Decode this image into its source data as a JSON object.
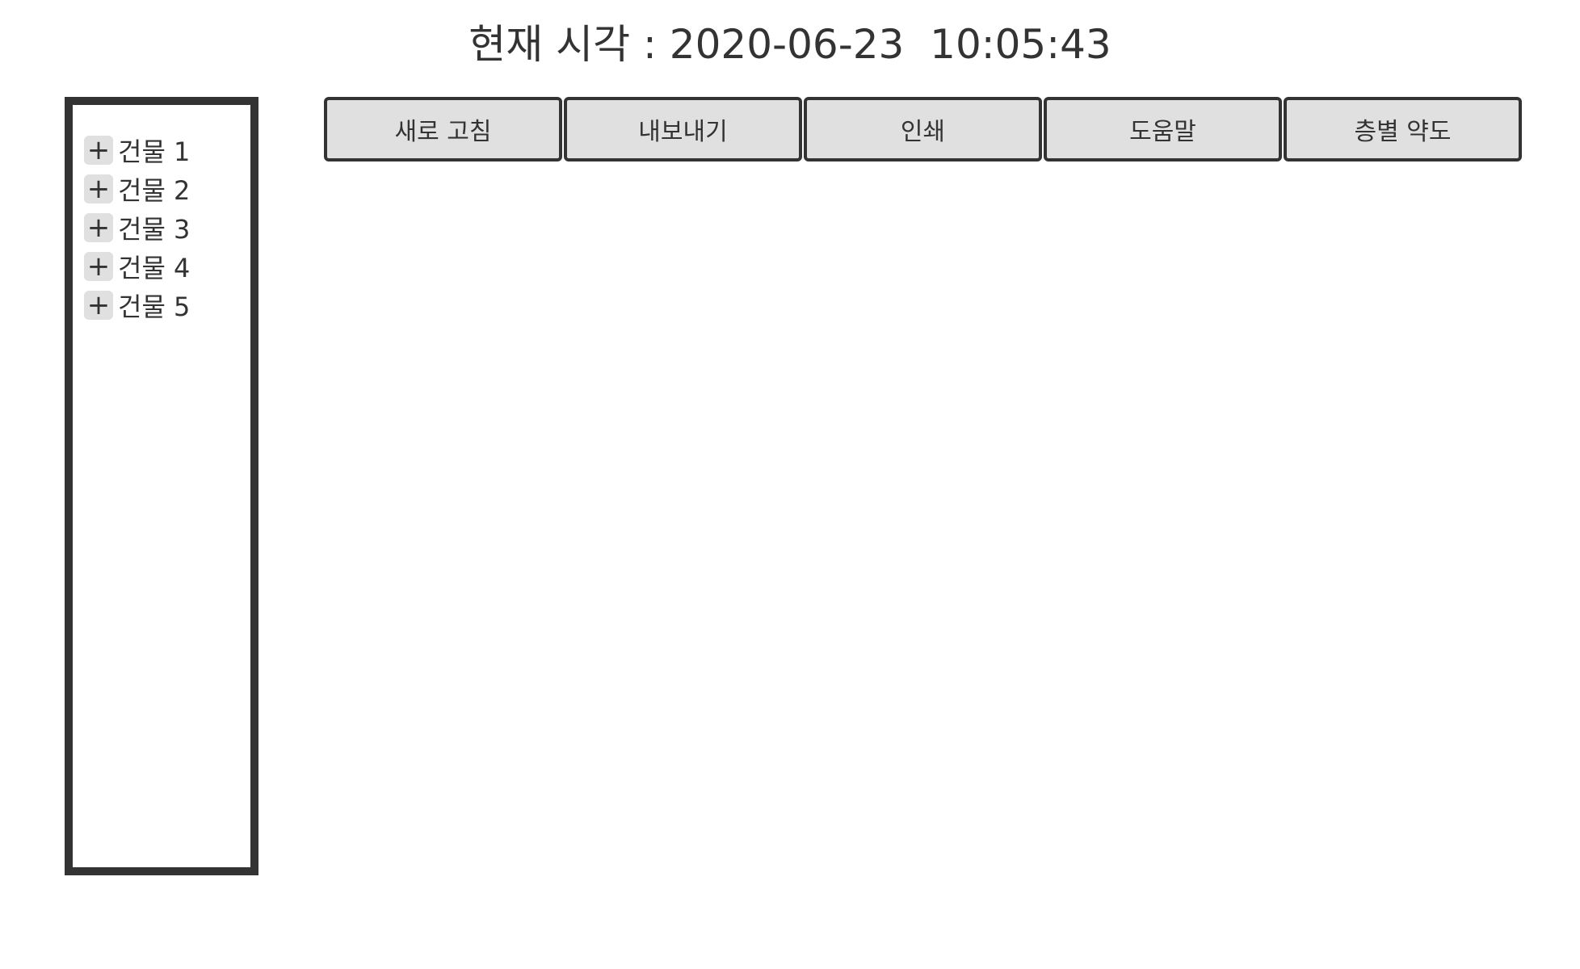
{
  "header": {
    "clock_text": "현재 시각 : 2020-06-23  10:05:43"
  },
  "building_tree": {
    "toggle_symbol": "+",
    "items": [
      {
        "label": "건물 1"
      },
      {
        "label": "건물 2"
      },
      {
        "label": "건물 3"
      },
      {
        "label": "건물 4"
      },
      {
        "label": "건물 5"
      }
    ]
  },
  "toolbar": {
    "buttons": [
      {
        "label": "새로 고침"
      },
      {
        "label": "내보내기"
      },
      {
        "label": "인쇄"
      },
      {
        "label": "도움말"
      },
      {
        "label": "층별 약도"
      }
    ]
  },
  "colors": {
    "border": "#333333",
    "button_fill": "#e0e0e0",
    "background": "#ffffff"
  }
}
